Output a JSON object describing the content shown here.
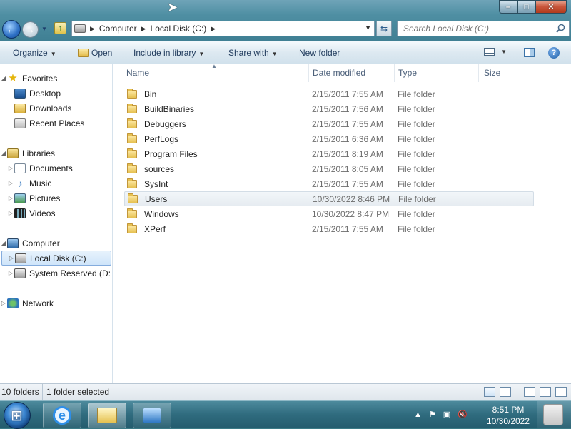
{
  "window": {
    "captions": {
      "minimize": "–",
      "maximize": "□",
      "close": "✕"
    }
  },
  "address_bar": {
    "crumbs": [
      "Computer",
      "Local Disk (C:)"
    ]
  },
  "search": {
    "placeholder": "Search Local Disk (C:)"
  },
  "toolbar": {
    "organize": "Organize",
    "open": "Open",
    "include_in_library": "Include in library",
    "share_with": "Share with",
    "new_folder": "New folder"
  },
  "nav_pane": {
    "favorites": "Favorites",
    "desktop": "Desktop",
    "downloads": "Downloads",
    "recent_places": "Recent Places",
    "libraries": "Libraries",
    "documents": "Documents",
    "music": "Music",
    "pictures": "Pictures",
    "videos": "Videos",
    "computer": "Computer",
    "local_disk": "Local Disk (C:)",
    "system_reserved": "System Reserved (D:",
    "network": "Network"
  },
  "columns": {
    "name": "Name",
    "date_modified": "Date modified",
    "type": "Type",
    "size": "Size"
  },
  "files": [
    {
      "name": "Bin",
      "date": "2/15/2011 7:55 AM",
      "type": "File folder"
    },
    {
      "name": "BuildBinaries",
      "date": "2/15/2011 7:56 AM",
      "type": "File folder"
    },
    {
      "name": "Debuggers",
      "date": "2/15/2011 7:55 AM",
      "type": "File folder"
    },
    {
      "name": "PerfLogs",
      "date": "2/15/2011 6:36 AM",
      "type": "File folder"
    },
    {
      "name": "Program Files",
      "date": "2/15/2011 8:19 AM",
      "type": "File folder"
    },
    {
      "name": "sources",
      "date": "2/15/2011 8:05 AM",
      "type": "File folder"
    },
    {
      "name": "SysInt",
      "date": "2/15/2011 7:55 AM",
      "type": "File folder"
    },
    {
      "name": "Users",
      "date": "10/30/2022 8:46 PM",
      "type": "File folder"
    },
    {
      "name": "Windows",
      "date": "10/30/2022 8:47 PM",
      "type": "File folder"
    },
    {
      "name": "XPerf",
      "date": "2/15/2011 7:55 AM",
      "type": "File folder"
    }
  ],
  "selected_file": "Users",
  "status": {
    "count": "10 folders",
    "selected": "1 folder selected"
  },
  "taskbar": {
    "time": "8:51 PM",
    "date": "10/30/2022"
  }
}
